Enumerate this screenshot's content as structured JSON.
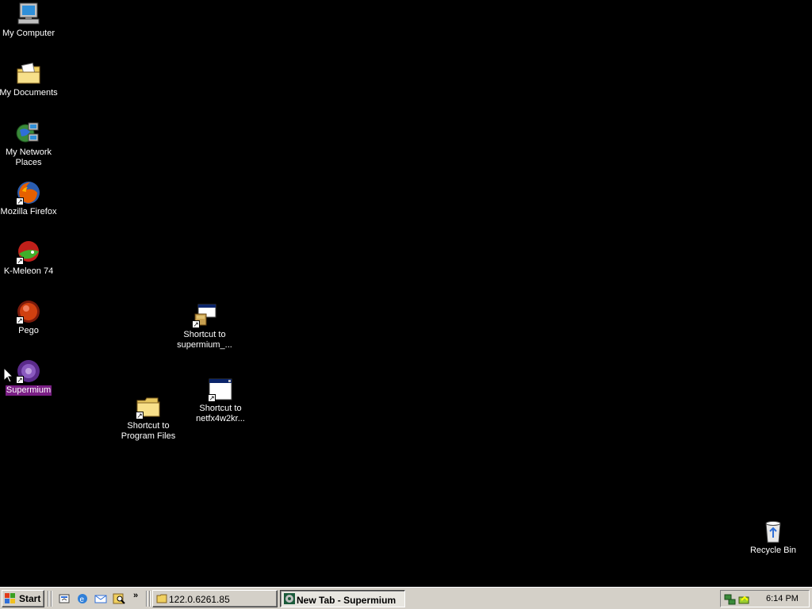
{
  "desktop": {
    "icons": [
      {
        "label": "My Computer",
        "icon": "my-computer-icon"
      },
      {
        "label": "My Documents",
        "icon": "my-documents-icon"
      },
      {
        "label": "My Network Places",
        "icon": "network-places-icon"
      },
      {
        "label": "Mozilla Firefox",
        "icon": "firefox-icon"
      },
      {
        "label": "K-Meleon 74",
        "icon": "k-meleon-icon"
      },
      {
        "label": "Pego",
        "icon": "pego-icon"
      },
      {
        "label": "Supermium",
        "icon": "supermium-icon",
        "selected": true
      },
      {
        "label": "Shortcut to supermium_...",
        "icon": "installer-icon"
      },
      {
        "label": "Shortcut to Program Files",
        "icon": "folder-icon"
      },
      {
        "label": "Shortcut to netfx4w2kr...",
        "icon": "window-app-icon"
      },
      {
        "label": "Recycle Bin",
        "icon": "recycle-bin-icon"
      }
    ],
    "selection_color": "#7b1f86"
  },
  "taskbar": {
    "start_label": "Start",
    "quick_launch": [
      "show-desktop-icon",
      "internet-explorer-icon",
      "outlook-express-icon",
      "search-icon"
    ],
    "more_label": "»",
    "tasks": [
      {
        "label": "122.0.6261.85",
        "icon": "folder-icon",
        "active": false
      },
      {
        "label": "New Tab - Supermium",
        "icon": "supermium-icon",
        "active": true
      }
    ],
    "clock": "6:14 PM"
  }
}
